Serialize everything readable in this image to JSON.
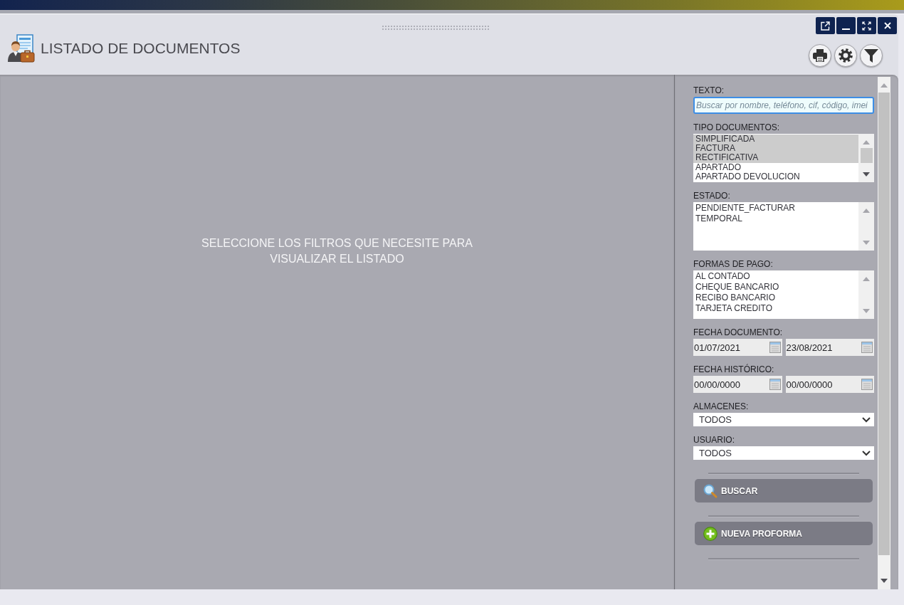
{
  "window": {
    "title": "LISTADO DE DOCUMENTOS"
  },
  "message": "SELECCIONE LOS FILTROS QUE NECESITE PARA VISUALIZAR EL LISTADO",
  "filters": [
    {
      "kind": "text",
      "label": "TEXTO:",
      "placeholder": "Buscar por nombre, teléfono, cif, código, imei",
      "focused": true
    },
    {
      "kind": "listbox",
      "label": "TIPO DOCUMENTOS:",
      "options": [
        {
          "text": "SIMPLIFICADA",
          "selected": true
        },
        {
          "text": "FACTURA",
          "selected": true
        },
        {
          "text": "RECTIFICATIVA",
          "selected": true
        },
        {
          "text": "APARTADO",
          "selected": false
        },
        {
          "text": "APARTADO DEVOLUCION",
          "selected": false
        }
      ]
    },
    {
      "kind": "listbox",
      "label": "ESTADO:",
      "options": [
        {
          "text": "PENDIENTE_FACTURAR",
          "selected": false
        },
        {
          "text": "TEMPORAL",
          "selected": false
        }
      ]
    },
    {
      "kind": "listbox",
      "label": "FORMAS DE PAGO:",
      "options": [
        {
          "text": "AL CONTADO",
          "selected": false
        },
        {
          "text": "CHEQUE BANCARIO",
          "selected": false
        },
        {
          "text": "RECIBO BANCARIO",
          "selected": false
        },
        {
          "text": "TARJETA CREDITO",
          "selected": false
        }
      ]
    },
    {
      "kind": "daterange",
      "label": "FECHA DOCUMENTO:",
      "values": [
        "01/07/2021",
        "23/08/2021"
      ]
    },
    {
      "kind": "daterange",
      "label": "FECHA HISTÓRICO:",
      "values": [
        "00/00/0000",
        "00/00/0000"
      ]
    },
    {
      "kind": "select",
      "label": "ALMACENES:",
      "value": "TODOS"
    },
    {
      "kind": "select",
      "label": "USUARIO:",
      "value": "TODOS"
    }
  ],
  "actions": [
    {
      "kind": "search",
      "label": "BUSCAR"
    },
    {
      "kind": "add",
      "label": "NUEVA PROFORMA"
    }
  ]
}
